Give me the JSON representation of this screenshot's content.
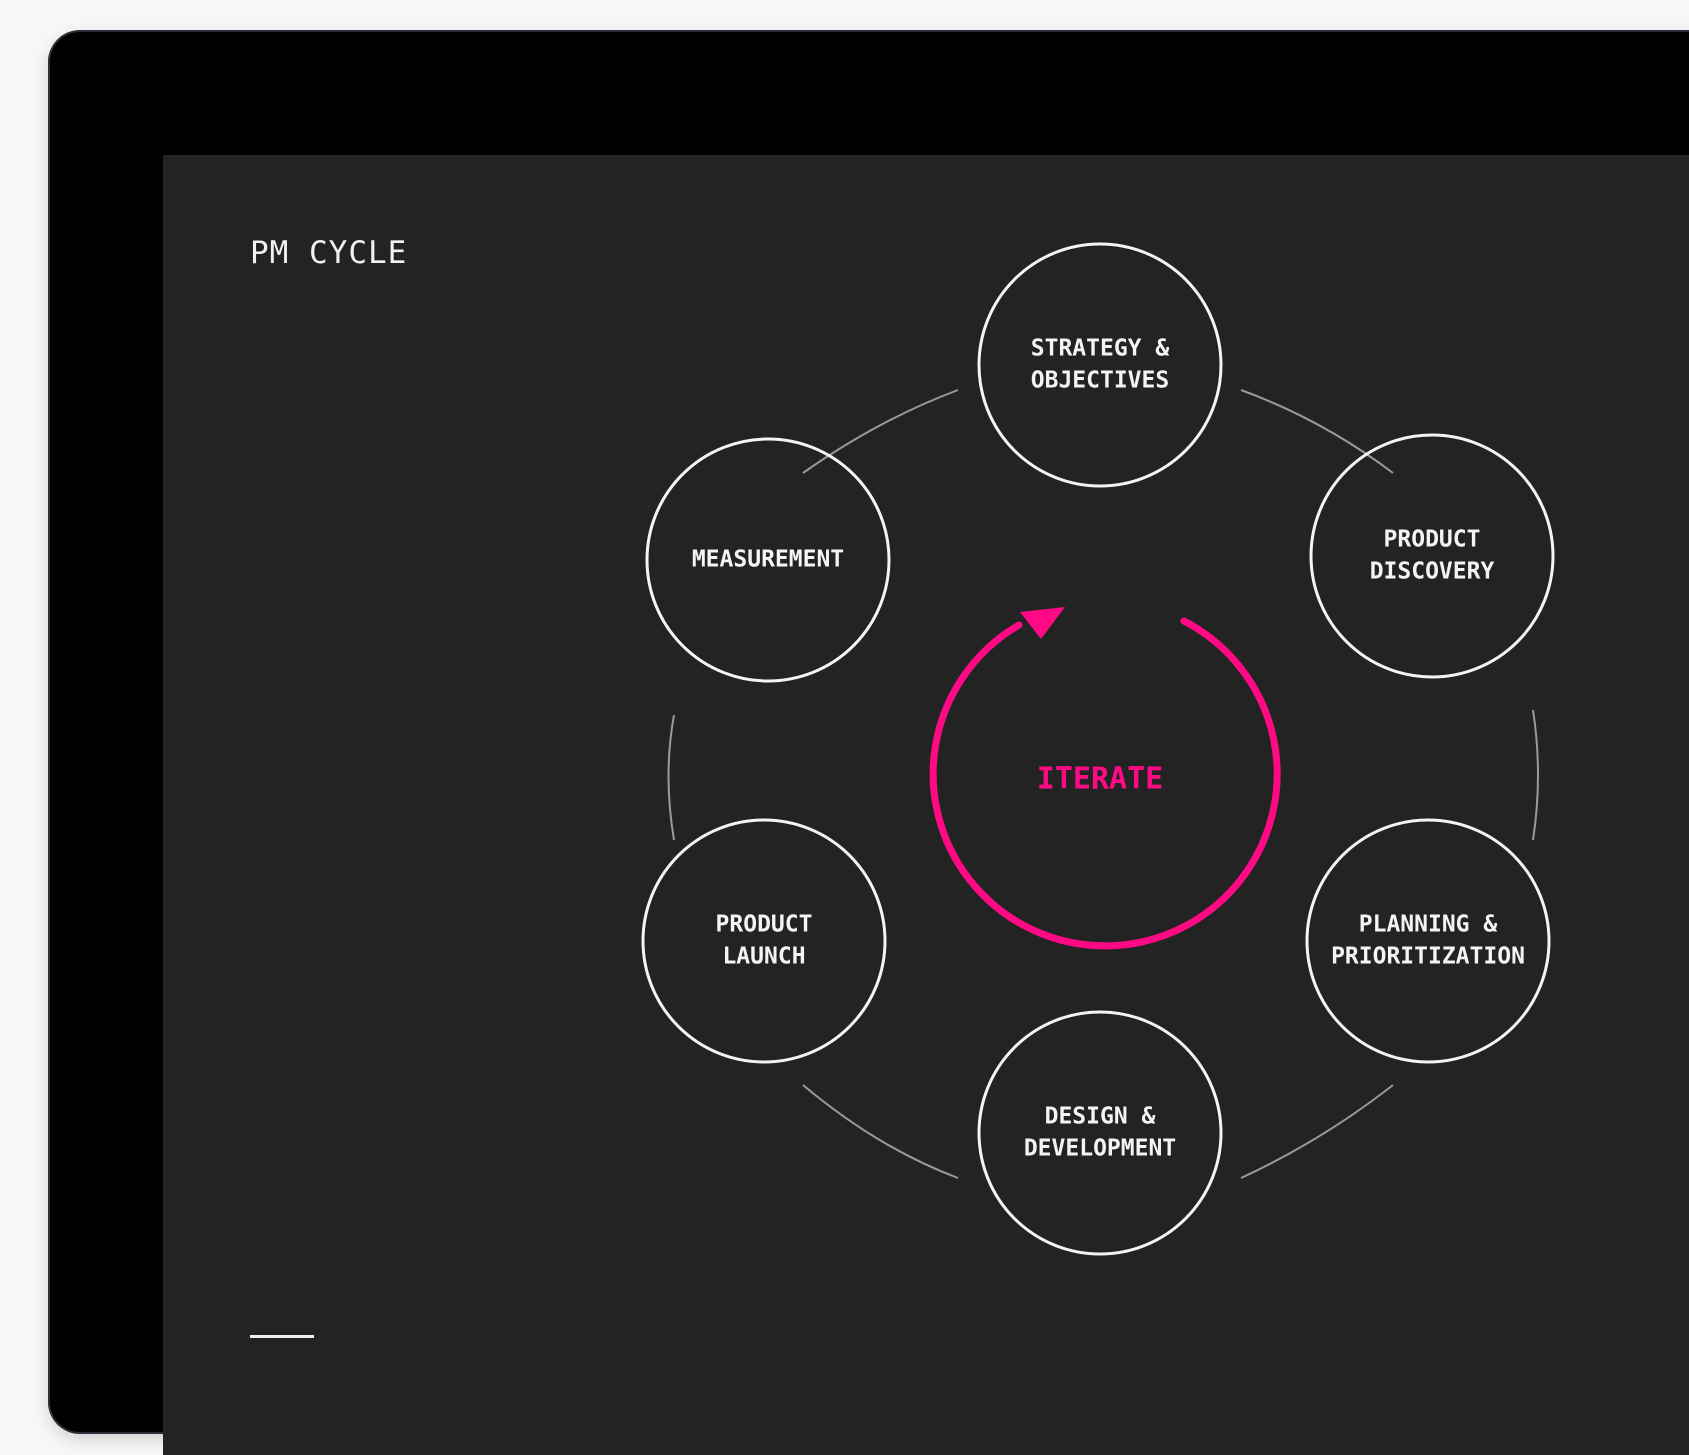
{
  "title": "PM CYCLE",
  "center": {
    "label": "ITERATE",
    "color": "#ff0a84"
  },
  "nodes": [
    {
      "id": "strategy",
      "lines": [
        "STRATEGY &",
        "OBJECTIVES"
      ]
    },
    {
      "id": "discovery",
      "lines": [
        "PRODUCT",
        "DISCOVERY"
      ]
    },
    {
      "id": "planning",
      "lines": [
        "PLANNING &",
        "PRIORITIZATION"
      ]
    },
    {
      "id": "design",
      "lines": [
        "DESIGN &",
        "DEVELOPMENT"
      ]
    },
    {
      "id": "launch",
      "lines": [
        "PRODUCT",
        "LAUNCH"
      ]
    },
    {
      "id": "measurement",
      "lines": [
        "MEASUREMENT"
      ]
    }
  ],
  "colors": {
    "background": "#232323",
    "node_stroke": "#f4f4f4",
    "connector": "#9a9a9a",
    "accent": "#ff0a84"
  }
}
